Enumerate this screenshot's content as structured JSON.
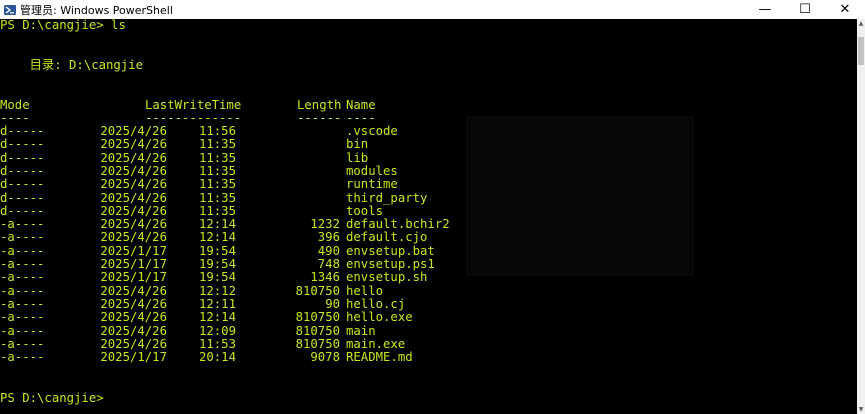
{
  "window": {
    "title": "管理员: Windows PowerShell",
    "minimize_glyph": "—",
    "maximize_glyph": "☐",
    "close_glyph": "✕"
  },
  "console": {
    "prompt_line": "PS D:\\cangjie> ls",
    "directory_label": "    目录: D:\\cangjie",
    "columns": {
      "mode": "Mode",
      "lastwrite": "LastWriteTime",
      "length": "Length",
      "name": "Name"
    },
    "underlines": {
      "mode": "----",
      "lastwrite": "-------------",
      "length": "------",
      "name": "----"
    },
    "rows": [
      {
        "mode": "d-----",
        "date": "2025/4/26",
        "time": "11:56",
        "length": "",
        "name": ".vscode"
      },
      {
        "mode": "d-----",
        "date": "2025/4/26",
        "time": "11:35",
        "length": "",
        "name": "bin"
      },
      {
        "mode": "d-----",
        "date": "2025/4/26",
        "time": "11:35",
        "length": "",
        "name": "lib"
      },
      {
        "mode": "d-----",
        "date": "2025/4/26",
        "time": "11:35",
        "length": "",
        "name": "modules"
      },
      {
        "mode": "d-----",
        "date": "2025/4/26",
        "time": "11:35",
        "length": "",
        "name": "runtime"
      },
      {
        "mode": "d-----",
        "date": "2025/4/26",
        "time": "11:35",
        "length": "",
        "name": "third_party"
      },
      {
        "mode": "d-----",
        "date": "2025/4/26",
        "time": "11:35",
        "length": "",
        "name": "tools"
      },
      {
        "mode": "-a----",
        "date": "2025/4/26",
        "time": "12:14",
        "length": "1232",
        "name": "default.bchir2"
      },
      {
        "mode": "-a----",
        "date": "2025/4/26",
        "time": "12:14",
        "length": "396",
        "name": "default.cjo"
      },
      {
        "mode": "-a----",
        "date": "2025/1/17",
        "time": "19:54",
        "length": "490",
        "name": "envsetup.bat"
      },
      {
        "mode": "-a----",
        "date": "2025/1/17",
        "time": "19:54",
        "length": "748",
        "name": "envsetup.ps1"
      },
      {
        "mode": "-a----",
        "date": "2025/1/17",
        "time": "19:54",
        "length": "1346",
        "name": "envsetup.sh"
      },
      {
        "mode": "-a----",
        "date": "2025/4/26",
        "time": "12:12",
        "length": "810750",
        "name": "hello"
      },
      {
        "mode": "-a----",
        "date": "2025/4/26",
        "time": "12:11",
        "length": "90",
        "name": "hello.cj"
      },
      {
        "mode": "-a----",
        "date": "2025/4/26",
        "time": "12:14",
        "length": "810750",
        "name": "hello.exe"
      },
      {
        "mode": "-a----",
        "date": "2025/4/26",
        "time": "12:09",
        "length": "810750",
        "name": "main"
      },
      {
        "mode": "-a----",
        "date": "2025/4/26",
        "time": "11:53",
        "length": "810750",
        "name": "main.exe"
      },
      {
        "mode": "-a----",
        "date": "2025/1/17",
        "time": "20:14",
        "length": "9078",
        "name": "README.md"
      }
    ],
    "final_prompt": "PS D:\\cangjie>"
  },
  "colors": {
    "text": "#c4e820",
    "background": "#000000"
  }
}
